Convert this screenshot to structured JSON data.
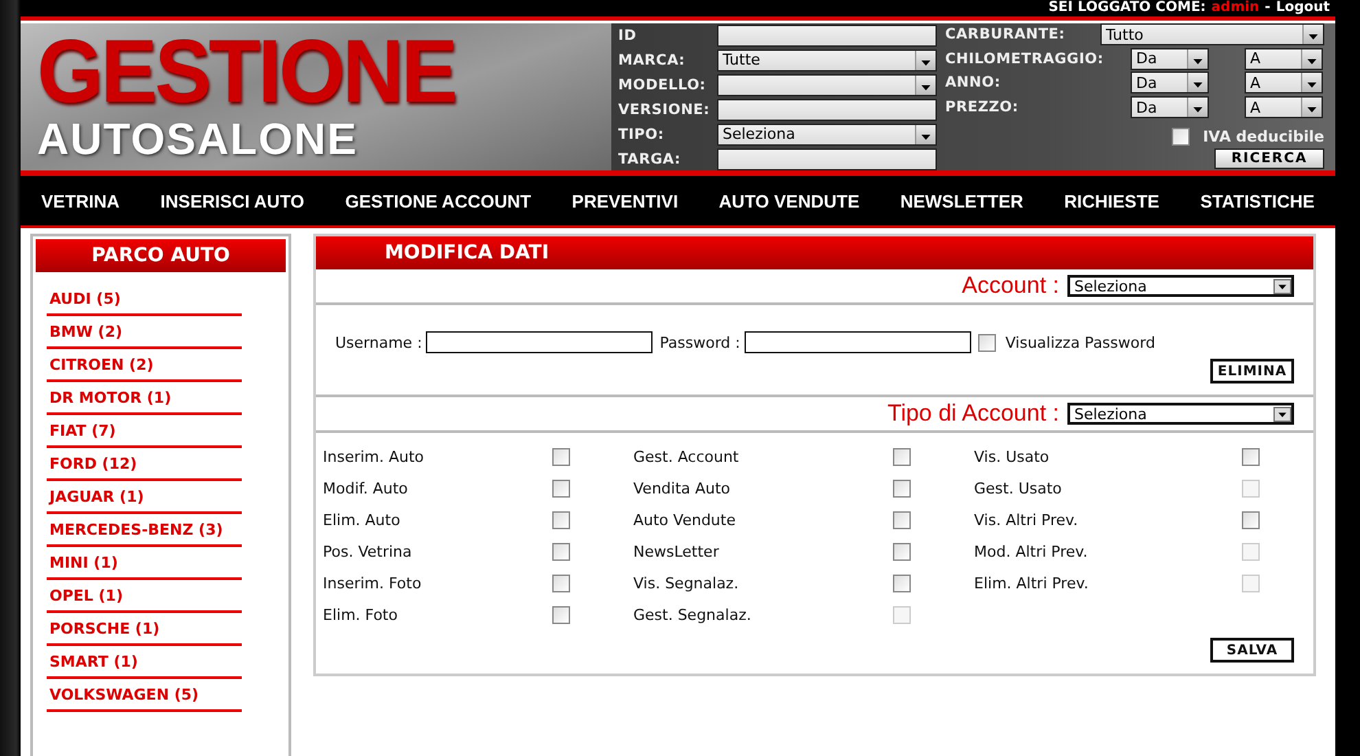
{
  "topbar": {
    "prefix": "SEI LOGGATO COME:",
    "user": "admin",
    "separator": "-",
    "logout": "Logout"
  },
  "logo": {
    "line1": "GESTIONE",
    "line2": "AUTOSALONE"
  },
  "search": {
    "left_fields": [
      {
        "label": "ID",
        "kind": "input"
      },
      {
        "label": "MARCA:",
        "kind": "select",
        "value": "Tutte"
      },
      {
        "label": "MODELLO:",
        "kind": "select"
      },
      {
        "label": "VERSIONE:",
        "kind": "input"
      },
      {
        "label": "TIPO:",
        "kind": "select",
        "value": "Seleziona"
      },
      {
        "label": "TARGA:",
        "kind": "input"
      }
    ],
    "right_fields": [
      {
        "label": "CARBURANTE:",
        "kind": "select",
        "value": "Tutto"
      },
      {
        "label": "CHILOMETRAGGIO:",
        "kind": "range",
        "from": "Da",
        "to": "A"
      },
      {
        "label": "ANNO:",
        "kind": "range",
        "from": "Da",
        "to": "A"
      },
      {
        "label": "PREZZO:",
        "kind": "range",
        "from": "Da",
        "to": "A"
      }
    ],
    "iva": {
      "label": "IVA deducibile",
      "checked": false
    },
    "button": "RICERCA"
  },
  "nav": [
    "VETRINA",
    "INSERISCI AUTO",
    "GESTIONE ACCOUNT",
    "PREVENTIVI",
    "AUTO VENDUTE",
    "NEWSLETTER",
    "RICHIESTE",
    "STATISTICHE"
  ],
  "sidebar": {
    "title": "PARCO AUTO",
    "items": [
      "AUDI (5)",
      "BMW (2)",
      "CITROEN (2)",
      "DR MOTOR (1)",
      "FIAT (7)",
      "FORD (12)",
      "JAGUAR (1)",
      "MERCEDES-BENZ (3)",
      "MINI (1)",
      "OPEL (1)",
      "PORSCHE (1)",
      "SMART (1)",
      "VOLKSWAGEN (5)"
    ]
  },
  "panel": {
    "title": "MODIFICA DATI",
    "account": {
      "label": "Account :",
      "value": "Seleziona"
    },
    "username_label": "Username :",
    "password_label": "Password :",
    "show_password": {
      "label": "Visualizza Password",
      "checked": false
    },
    "delete_button": "ELIMINA",
    "account_type": {
      "label": "Tipo di Account :",
      "value": "Seleziona"
    },
    "permissions": [
      [
        {
          "label": "Inserim. Auto",
          "checked": false,
          "disabled": false
        },
        {
          "label": "Modif. Auto",
          "checked": false,
          "disabled": false
        },
        {
          "label": "Elim. Auto",
          "checked": false,
          "disabled": false
        },
        {
          "label": "Pos. Vetrina",
          "checked": false,
          "disabled": false
        },
        {
          "label": "Inserim. Foto",
          "checked": false,
          "disabled": false
        },
        {
          "label": "Elim. Foto",
          "checked": false,
          "disabled": false
        }
      ],
      [
        {
          "label": "Gest. Account",
          "checked": false,
          "disabled": false
        },
        {
          "label": "Vendita Auto",
          "checked": false,
          "disabled": false
        },
        {
          "label": "Auto Vendute",
          "checked": false,
          "disabled": false
        },
        {
          "label": "NewsLetter",
          "checked": false,
          "disabled": false
        },
        {
          "label": "Vis. Segnalaz.",
          "checked": false,
          "disabled": false
        },
        {
          "label": "Gest. Segnalaz.",
          "checked": false,
          "disabled": true
        }
      ],
      [
        {
          "label": "Vis. Usato",
          "checked": false,
          "disabled": false
        },
        {
          "label": "Gest. Usato",
          "checked": false,
          "disabled": true
        },
        {
          "label": "Vis. Altri Prev.",
          "checked": false,
          "disabled": false
        },
        {
          "label": "Mod. Altri Prev.",
          "checked": false,
          "disabled": true
        },
        {
          "label": "Elim. Altri Prev.",
          "checked": false,
          "disabled": true
        }
      ]
    ],
    "save_button": "SALVA"
  }
}
